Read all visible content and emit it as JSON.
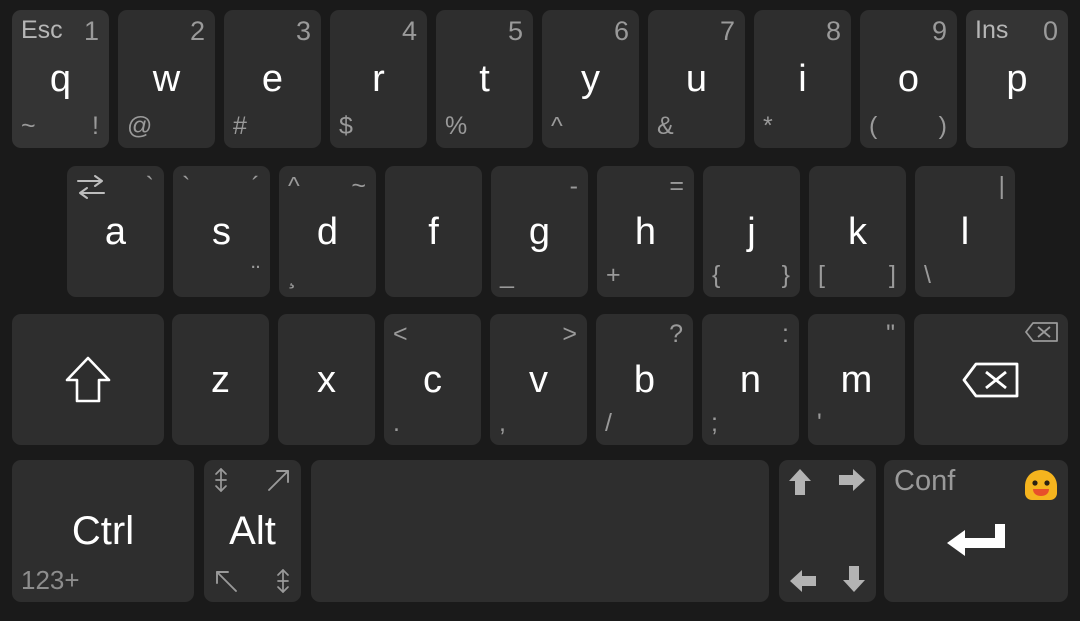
{
  "keyboard": {
    "theme": {
      "background": "#1a1a1a",
      "key_background": "#2e2e2e",
      "key_background_highlight": "#343434",
      "primary_text": "#ffffff",
      "secondary_text": "#9a9a9a",
      "emoji_face": "#f5b41e",
      "emoji_mouth": "#e8502a"
    },
    "rows": [
      {
        "name": "row-1",
        "keys": [
          {
            "id": "q",
            "main": "q",
            "tl": "Esc",
            "tr": "1",
            "bl": "~",
            "br": "!",
            "highlight": true
          },
          {
            "id": "w",
            "main": "w",
            "tr": "2",
            "bl": "@"
          },
          {
            "id": "e",
            "main": "e",
            "tr": "3",
            "bl": "#"
          },
          {
            "id": "r",
            "main": "r",
            "tr": "4",
            "bl": "$"
          },
          {
            "id": "t",
            "main": "t",
            "tr": "5",
            "bl": "%"
          },
          {
            "id": "y",
            "main": "y",
            "tr": "6",
            "bl": "^"
          },
          {
            "id": "u",
            "main": "u",
            "tr": "7",
            "bl": "&"
          },
          {
            "id": "i",
            "main": "i",
            "tr": "8",
            "bl": "*"
          },
          {
            "id": "o",
            "main": "o",
            "tr": "9",
            "bl": "(",
            "br": ")"
          },
          {
            "id": "p",
            "main": "p",
            "tl": "Ins",
            "tr": "0",
            "highlight": true
          }
        ]
      },
      {
        "name": "row-2",
        "keys": [
          {
            "id": "a",
            "main": "a",
            "tl_icon": "tab-icon",
            "tr": "`"
          },
          {
            "id": "s",
            "main": "s",
            "tl": "`",
            "tr": "´",
            "br": "¨"
          },
          {
            "id": "d",
            "main": "d",
            "tl": "^",
            "tr": "~",
            "bl": "¸"
          },
          {
            "id": "f",
            "main": "f"
          },
          {
            "id": "g",
            "main": "g",
            "tr": "-",
            "bl": "_"
          },
          {
            "id": "h",
            "main": "h",
            "tr": "=",
            "bl": "+"
          },
          {
            "id": "j",
            "main": "j",
            "bl": "{",
            "br": "}"
          },
          {
            "id": "k",
            "main": "k",
            "bl": "[",
            "br": "]"
          },
          {
            "id": "l",
            "main": "l",
            "tr": "|",
            "bl": "\\"
          }
        ]
      },
      {
        "name": "row-3",
        "keys": [
          {
            "id": "shift",
            "main_icon": "shift-icon"
          },
          {
            "id": "z",
            "main": "z"
          },
          {
            "id": "x",
            "main": "x"
          },
          {
            "id": "c",
            "main": "c",
            "tl": "<",
            "bl": "."
          },
          {
            "id": "v",
            "main": "v",
            "tr": ">",
            "bl": ","
          },
          {
            "id": "b",
            "main": "b",
            "tr": "?",
            "bl": "/"
          },
          {
            "id": "n",
            "main": "n",
            "tr": ":",
            "bl": ";"
          },
          {
            "id": "m",
            "main": "m",
            "tr": "\"",
            "bl": "'"
          },
          {
            "id": "backspace",
            "main_icon": "backspace-icon",
            "tr_icon": "backspace-small-icon"
          }
        ]
      },
      {
        "name": "row-4",
        "keys": [
          {
            "id": "ctrl",
            "main": "Ctrl",
            "bl": "123+"
          },
          {
            "id": "alt",
            "main": "Alt",
            "tl_icon": "page-up-icon",
            "tr_icon": "arrow-up-right-icon",
            "bl_icon": "arrow-up-left-icon",
            "br_icon": "page-down-icon"
          },
          {
            "id": "space",
            "main": ""
          },
          {
            "id": "arrows",
            "tl_icon": "arrow-up-icon",
            "tr_icon": "arrow-right-icon",
            "bl_icon": "arrow-left-icon",
            "br_icon": "arrow-down-icon"
          },
          {
            "id": "enter",
            "tl": "Conf",
            "tr_icon": "emoji-icon",
            "main_icon": "enter-icon"
          }
        ]
      }
    ]
  }
}
